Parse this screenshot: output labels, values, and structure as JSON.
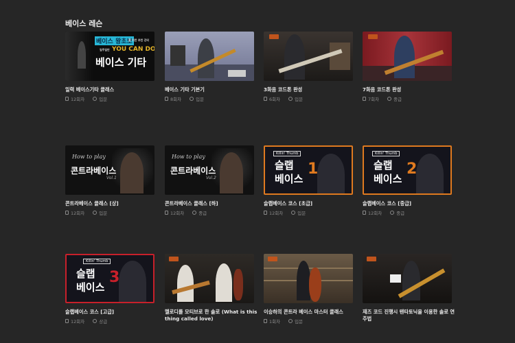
{
  "section": {
    "title": "베이스 레슨"
  },
  "cards": [
    {
      "title": "일력 베이스기타 클래스",
      "count": "12회차",
      "level": "입문",
      "thumb": {
        "top_banner": "베이스 왕초보",
        "top_small": "를 위한 추천 강의",
        "mid_small": "일주일만",
        "mid_big": "YOU CAN DO",
        "big": "베이스 기타"
      }
    },
    {
      "title": "베이스 기타 기본기",
      "count": "8회차",
      "level": "입문",
      "thumb": {}
    },
    {
      "title": "3화음 코드톤 완성",
      "count": "6회차",
      "level": "입문",
      "thumb": {}
    },
    {
      "title": "7화음 코드톤 완성",
      "count": "7회차",
      "level": "중급",
      "thumb": {}
    },
    {
      "title": "콘트라베이스 클래스 [상]",
      "count": "12회차",
      "level": "입문",
      "thumb": {
        "script": "How to play",
        "big": "콘트라베이스",
        "vol": "Vol.1"
      }
    },
    {
      "title": "콘트라베이스 클래스 [하]",
      "count": "12회차",
      "level": "중급",
      "thumb": {
        "script": "How to play",
        "big": "콘트라베이스",
        "vol": "Vol.2"
      }
    },
    {
      "title": "슬랩베이스 코스 [초급]",
      "count": "12회차",
      "level": "입문",
      "thumb": {
        "brand": "Killin' Thumb",
        "line1": "슬랩",
        "line2": "베이스",
        "num": "1"
      }
    },
    {
      "title": "슬랩베이스 코스 [중급]",
      "count": "12회차",
      "level": "중급",
      "thumb": {
        "brand": "Killin' Thumb",
        "line1": "슬랩",
        "line2": "베이스",
        "num": "2"
      }
    },
    {
      "title": "슬랩베이스 코스 [고급]",
      "count": "12회차",
      "level": "상급",
      "thumb": {
        "brand": "Killin' Thumb",
        "line1": "슬랩",
        "line2": "베이스",
        "num": "3"
      }
    },
    {
      "title": "멜로디를 모티브로 한 솔로 (What is this thing called love)",
      "count": "",
      "level": "",
      "thumb": {}
    },
    {
      "title": "이승하의 콘트라 베이스 마스터 클래스",
      "count": "1회차",
      "level": "입문",
      "thumb": {}
    },
    {
      "title": "재즈 코드 진행시 텐타토닉을 이용한 솔로 연주법",
      "count": "",
      "level": "",
      "thumb": {}
    }
  ],
  "colors": {
    "background": "#262626",
    "accent_orange": "#e07a1f",
    "accent_red": "#c8202a",
    "banner_cyan": "#27b6d6"
  }
}
